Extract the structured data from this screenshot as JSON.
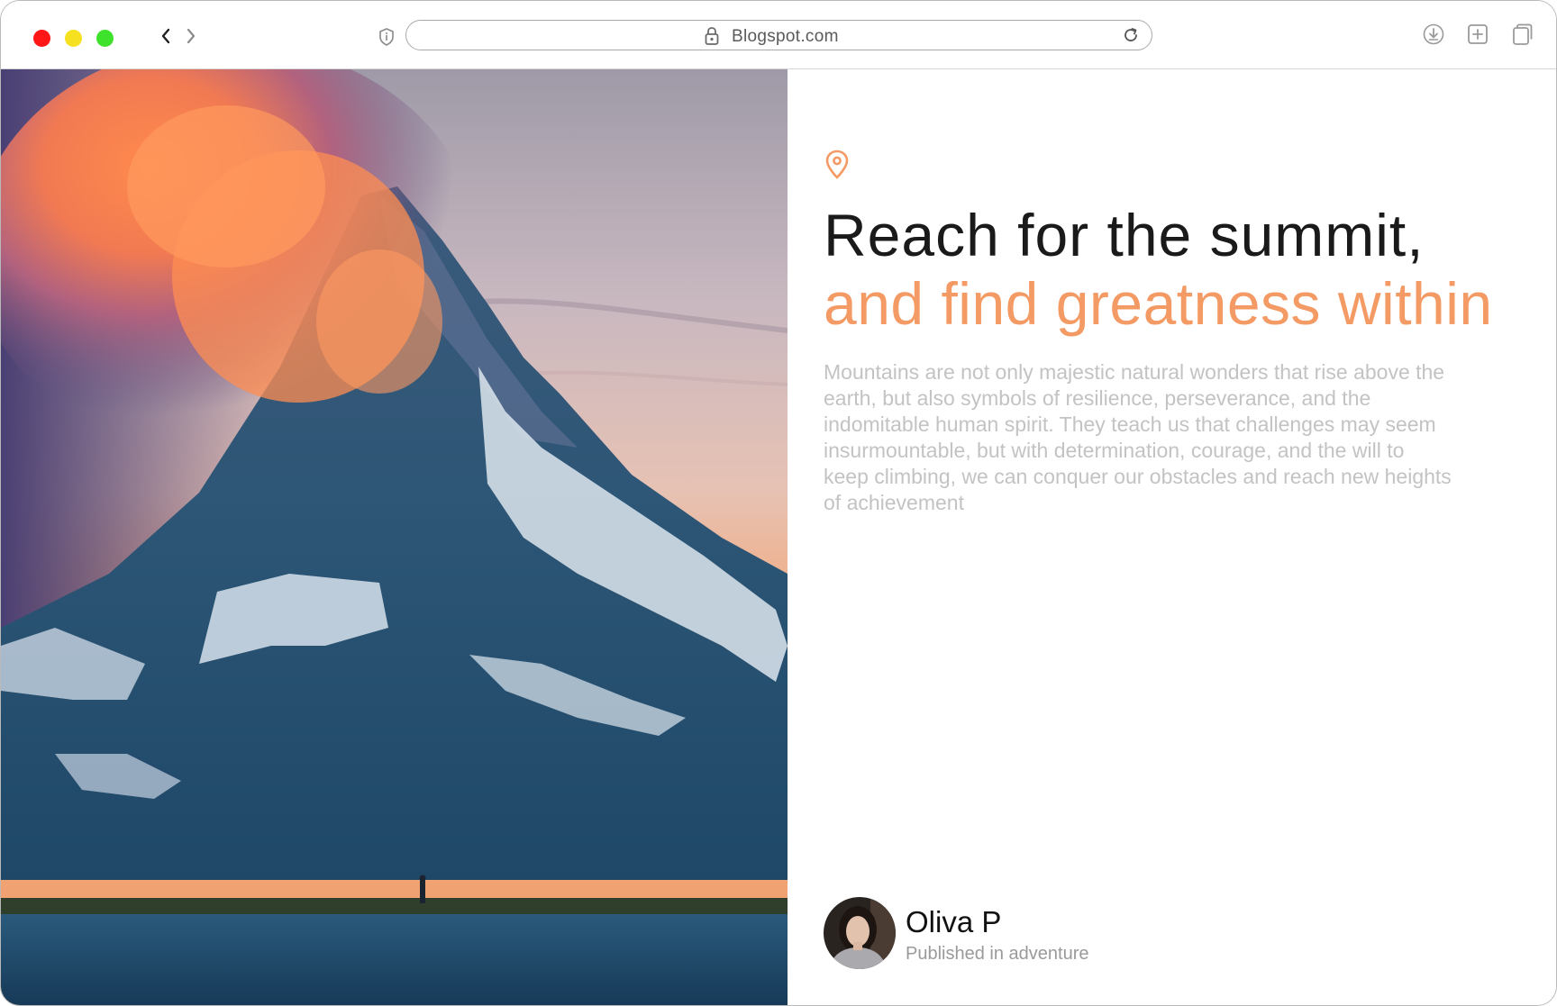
{
  "browser": {
    "url": "Blogspot.com",
    "traffic_lights": {
      "close": "#ff1616",
      "minimize": "#f5e11f",
      "maximize": "#3fe22b"
    }
  },
  "article": {
    "title_line1": "Reach for the summit,",
    "title_line2": "and find greatness within",
    "body": "Mountains are not only majestic natural wonders that rise above the earth, but also symbols of resilience, perseverance, and the indomitable human spirit. They teach us that challenges may seem insurmountable, but with determination, courage, and the will to keep climbing, we can conquer our obstacles and reach new heights of achievement",
    "accent_color": "#f49a64"
  },
  "author": {
    "name": "Oliva P",
    "meta": "Published in adventure"
  },
  "icons": [
    "back-icon",
    "forward-icon",
    "shield-icon",
    "lock-icon",
    "reload-icon",
    "download-icon",
    "new-tab-icon",
    "tabs-icon",
    "location-pin-icon"
  ]
}
